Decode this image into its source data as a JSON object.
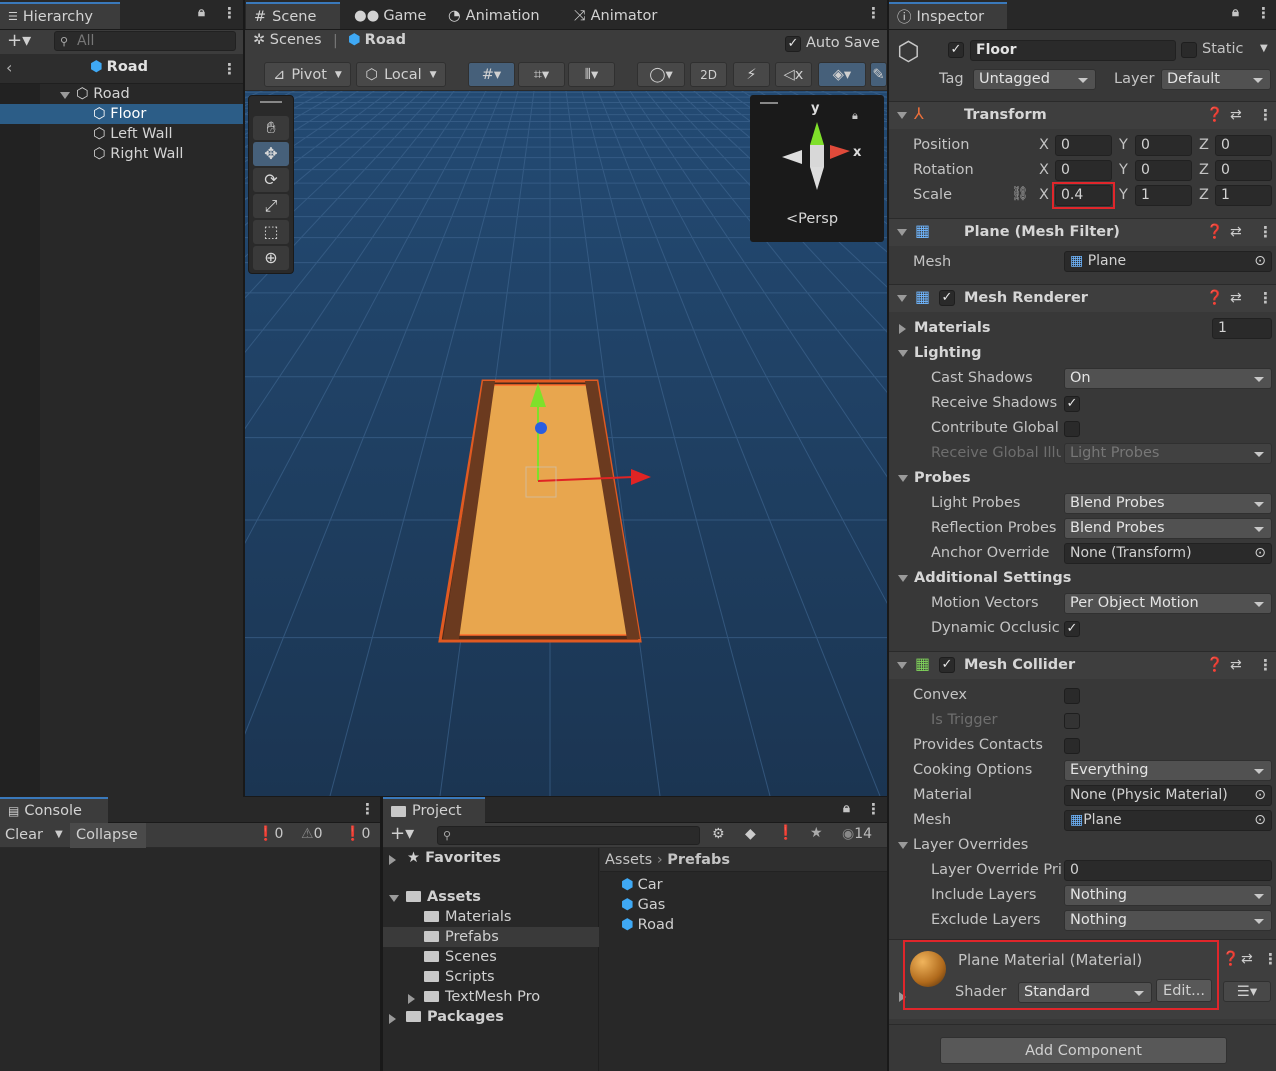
{
  "hierarchy": {
    "tab": "Hierarchy",
    "search_placeholder": "All",
    "scene_title": "Road",
    "items": [
      {
        "label": "Road"
      },
      {
        "label": "Floor"
      },
      {
        "label": "Left Wall"
      },
      {
        "label": "Right Wall"
      }
    ]
  },
  "scene_tabs": [
    {
      "label": "Scene"
    },
    {
      "label": "Game"
    },
    {
      "label": "Animation"
    },
    {
      "label": "Animator"
    }
  ],
  "scene_bar": {
    "scenes": "Scenes",
    "prefab": "Road",
    "auto_save": "Auto Save"
  },
  "scene_toolbar": {
    "pivot": "Pivot",
    "local": "Local",
    "two_d": "2D"
  },
  "gizmo": {
    "y": "y",
    "x": "x",
    "persp": "Persp"
  },
  "console": {
    "tab": "Console",
    "clear": "Clear",
    "collapse": "Collapse",
    "errors": "0",
    "warnings": "0",
    "logs": "0"
  },
  "project": {
    "tab": "Project",
    "hidden_count": "14",
    "favorites": "Favorites",
    "assets": "Assets",
    "folders": [
      "Materials",
      "Prefabs",
      "Scenes",
      "Scripts",
      "TextMesh Pro"
    ],
    "packages": "Packages",
    "breadcrumb": {
      "root": "Assets",
      "current": "Prefabs"
    },
    "files": [
      "Car",
      "Gas",
      "Road"
    ]
  },
  "inspector": {
    "tab": "Inspector",
    "object_name": "Floor",
    "static": "Static",
    "tag_label": "Tag",
    "tag_value": "Untagged",
    "layer_label": "Layer",
    "layer_value": "Default",
    "transform": {
      "title": "Transform",
      "position": {
        "label": "Position",
        "x": "0",
        "y": "0",
        "z": "0"
      },
      "rotation": {
        "label": "Rotation",
        "x": "0",
        "y": "0",
        "z": "0"
      },
      "scale": {
        "label": "Scale",
        "x": "0.4",
        "y": "1",
        "z": "1"
      }
    },
    "mesh_filter": {
      "title": "Plane (Mesh Filter)",
      "mesh_label": "Mesh",
      "mesh_value": "Plane"
    },
    "mesh_renderer": {
      "title": "Mesh Renderer",
      "materials": "Materials",
      "materials_count": "1",
      "lighting": "Lighting",
      "cast_shadows": "Cast Shadows",
      "cast_shadows_value": "On",
      "receive_shadows": "Receive Shadows",
      "contribute_global": "Contribute Global",
      "receive_global": "Receive Global Illu",
      "receive_global_value": "Light Probes",
      "probes": "Probes",
      "light_probes": "Light Probes",
      "light_probes_value": "Blend Probes",
      "reflection_probes": "Reflection Probes",
      "reflection_probes_value": "Blend Probes",
      "anchor_override": "Anchor Override",
      "anchor_override_value": "None (Transform)",
      "additional": "Additional Settings",
      "motion_vectors": "Motion Vectors",
      "motion_vectors_value": "Per Object Motion",
      "dynamic_occlusion": "Dynamic Occlusic"
    },
    "mesh_collider": {
      "title": "Mesh Collider",
      "convex": "Convex",
      "is_trigger": "Is Trigger",
      "provides_contacts": "Provides Contacts",
      "cooking_options": "Cooking Options",
      "cooking_value": "Everything",
      "material": "Material",
      "material_value": "None (Physic Material)",
      "mesh": "Mesh",
      "mesh_value": "Plane",
      "layer_overrides": "Layer Overrides",
      "layer_override_priority": "Layer Override Pri",
      "layer_override_priority_value": "0",
      "include_layers": "Include Layers",
      "include_value": "Nothing",
      "exclude_layers": "Exclude Layers",
      "exclude_value": "Nothing"
    },
    "material": {
      "title": "Plane Material (Material)",
      "shader_label": "Shader",
      "shader_value": "Standard",
      "edit": "Edit..."
    },
    "add_component": "Add Component"
  },
  "colors": {
    "accent_blue": "#2c5d87",
    "highlight_red": "#e0262b",
    "floor_orange": "#e8a64e",
    "scene_bg": "#1f3a5c"
  }
}
